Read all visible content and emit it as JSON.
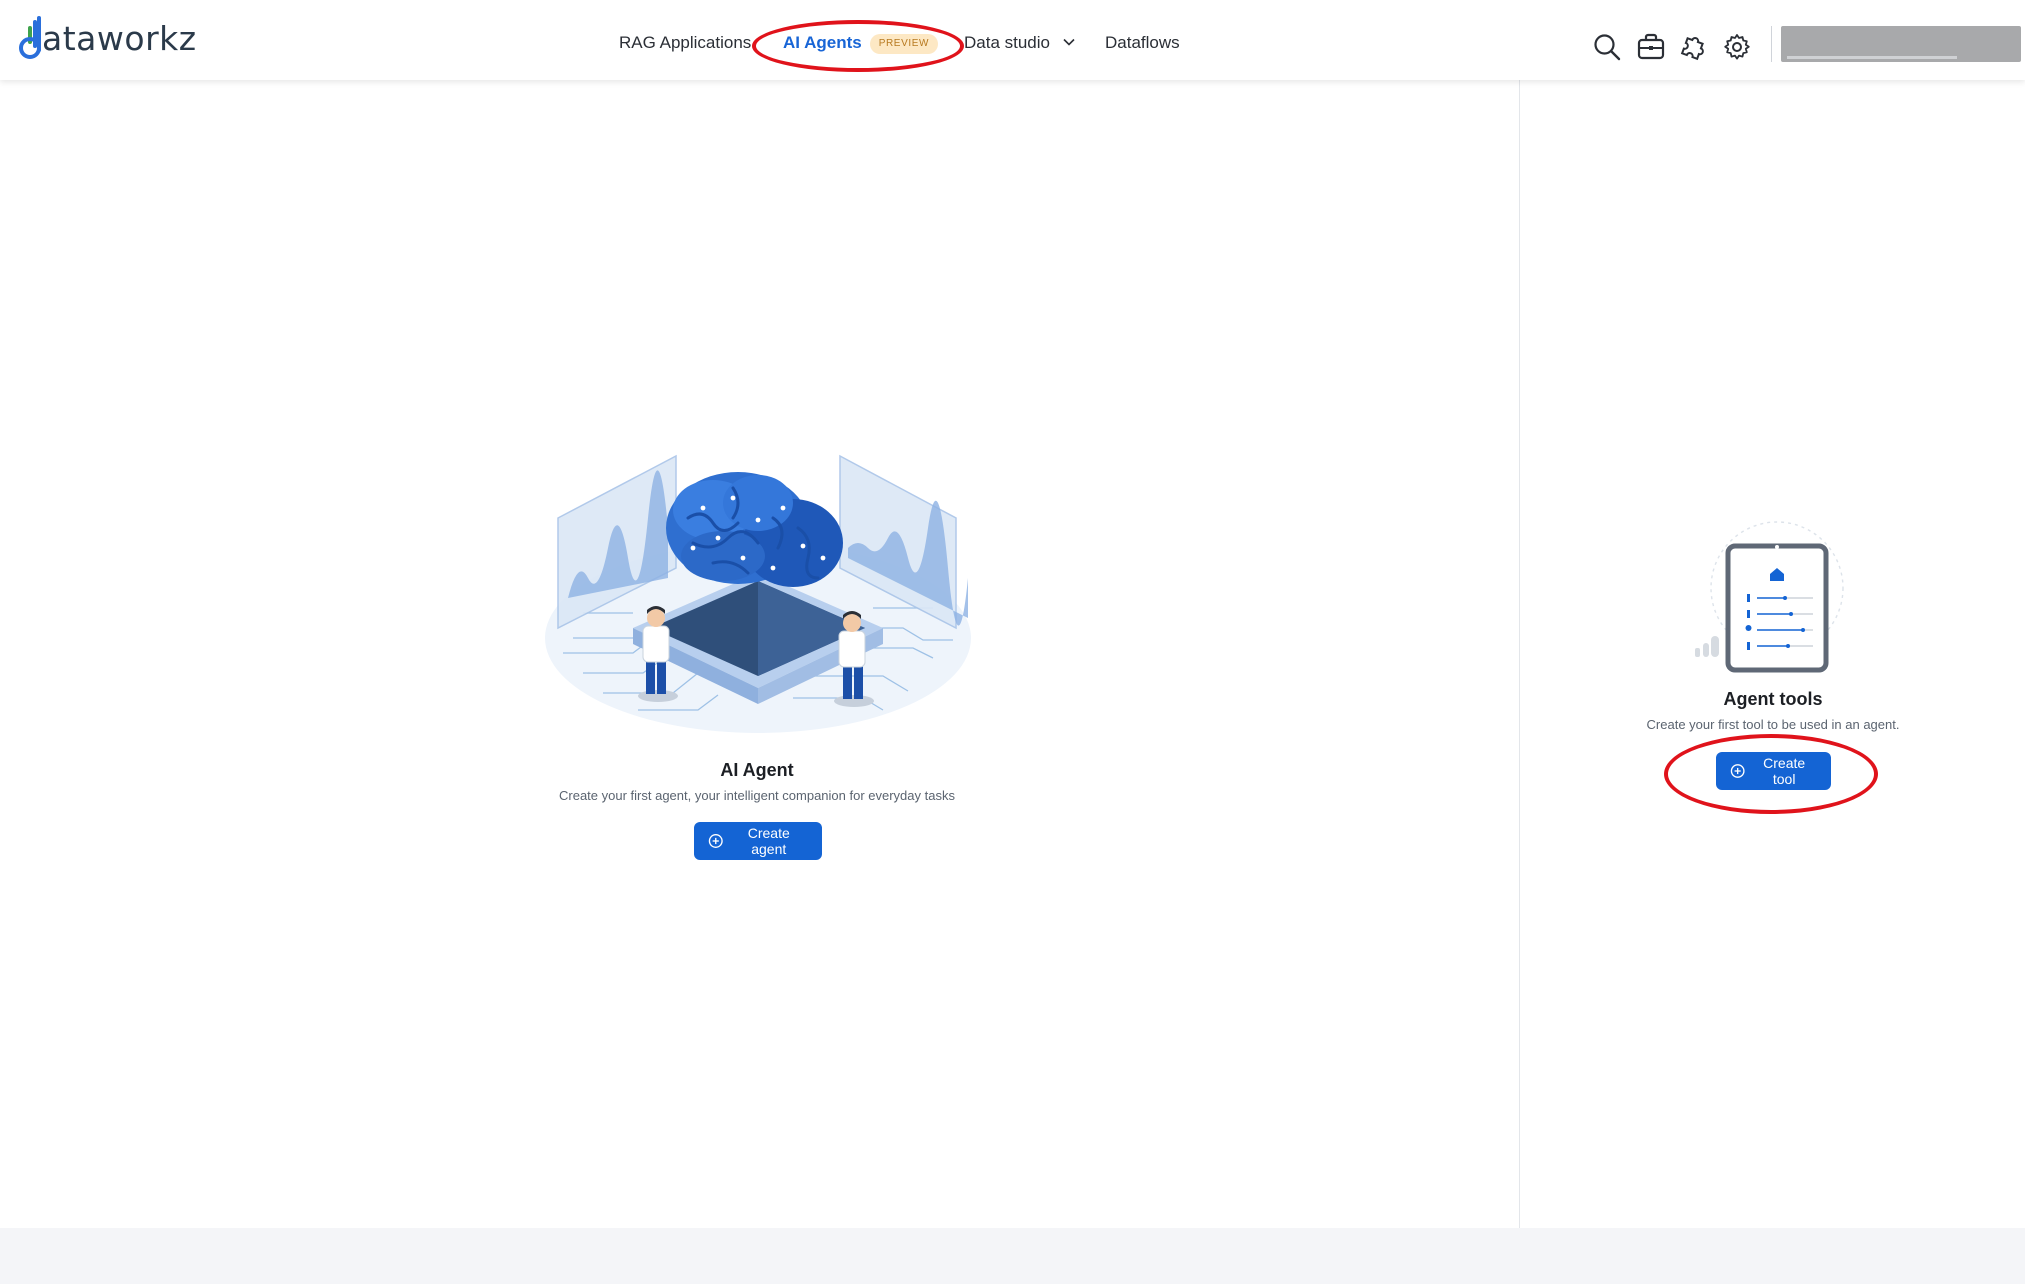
{
  "brand": {
    "logo_text": "ataworkz"
  },
  "nav": {
    "items": [
      {
        "label": "RAG Applications"
      },
      {
        "label": "AI Agents",
        "badge": "PREVIEW",
        "active": true
      },
      {
        "label": "Data studio",
        "has_dropdown": true
      },
      {
        "label": "Dataflows"
      }
    ]
  },
  "header_icons": [
    "search-icon",
    "briefcase-icon",
    "puzzle-icon",
    "gear-icon"
  ],
  "agent_card": {
    "title": "AI Agent",
    "description": "Create your first agent, your intelligent companion for everyday tasks",
    "button_label": "Create agent"
  },
  "tools_card": {
    "title": "Agent tools",
    "description": "Create your first tool to be used in an agent.",
    "button_label": "Create tool"
  },
  "colors": {
    "accent": "#1464d4",
    "annotation": "#e0131b",
    "badge_bg": "#fde8c4",
    "badge_text": "#b7791f"
  }
}
